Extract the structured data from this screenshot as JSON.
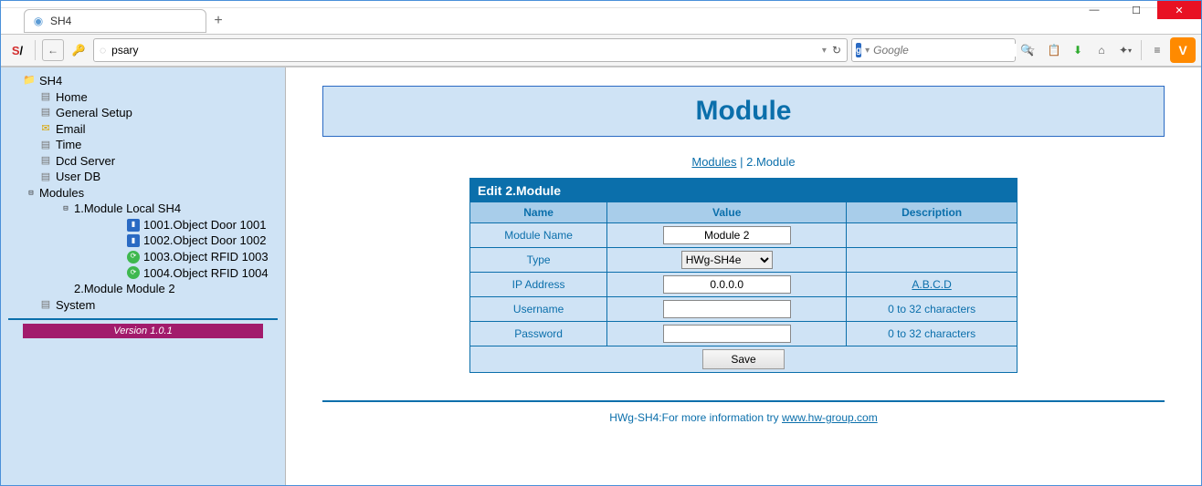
{
  "browser": {
    "tab_title": "SH4",
    "address": "psary",
    "search_placeholder": "Google"
  },
  "sidebar": {
    "root": "SH4",
    "items": [
      {
        "label": "Home",
        "icon": "page"
      },
      {
        "label": "General Setup",
        "icon": "page"
      },
      {
        "label": "Email",
        "icon": "env"
      },
      {
        "label": "Time",
        "icon": "page"
      },
      {
        "label": "Dcd Server",
        "icon": "page"
      },
      {
        "label": "User DB",
        "icon": "page"
      }
    ],
    "modules_label": "Modules",
    "module1": {
      "label": "1.Module Local SH4",
      "children": [
        {
          "label": "1001.Object Door 1001",
          "icon": "blue"
        },
        {
          "label": "1002.Object Door 1002",
          "icon": "blue"
        },
        {
          "label": "1003.Object RFID 1003",
          "icon": "green"
        },
        {
          "label": "1004.Object RFID 1004",
          "icon": "green"
        }
      ]
    },
    "module2_label": "2.Module Module 2",
    "system_label": "System",
    "version": "Version 1.0.1"
  },
  "page": {
    "title": "Module",
    "breadcrumb_link": "Modules",
    "breadcrumb_sep": " | ",
    "breadcrumb_current": "2.Module",
    "edit_title": "Edit 2.Module",
    "columns": {
      "name": "Name",
      "value": "Value",
      "desc": "Description"
    },
    "rows": {
      "module_name": {
        "label": "Module Name",
        "value": "Module 2",
        "desc": ""
      },
      "type": {
        "label": "Type",
        "value": "HWg-SH4e",
        "desc": ""
      },
      "ip": {
        "label": "IP Address",
        "value": "0.0.0.0",
        "desc": "A.B.C.D"
      },
      "username": {
        "label": "Username",
        "value": "",
        "desc": "0 to 32 characters"
      },
      "password": {
        "label": "Password",
        "value": "",
        "desc": "0 to 32 characters"
      }
    },
    "save_label": "Save",
    "footer_text": "HWg-SH4:For more information try ",
    "footer_link": "www.hw-group.com"
  }
}
